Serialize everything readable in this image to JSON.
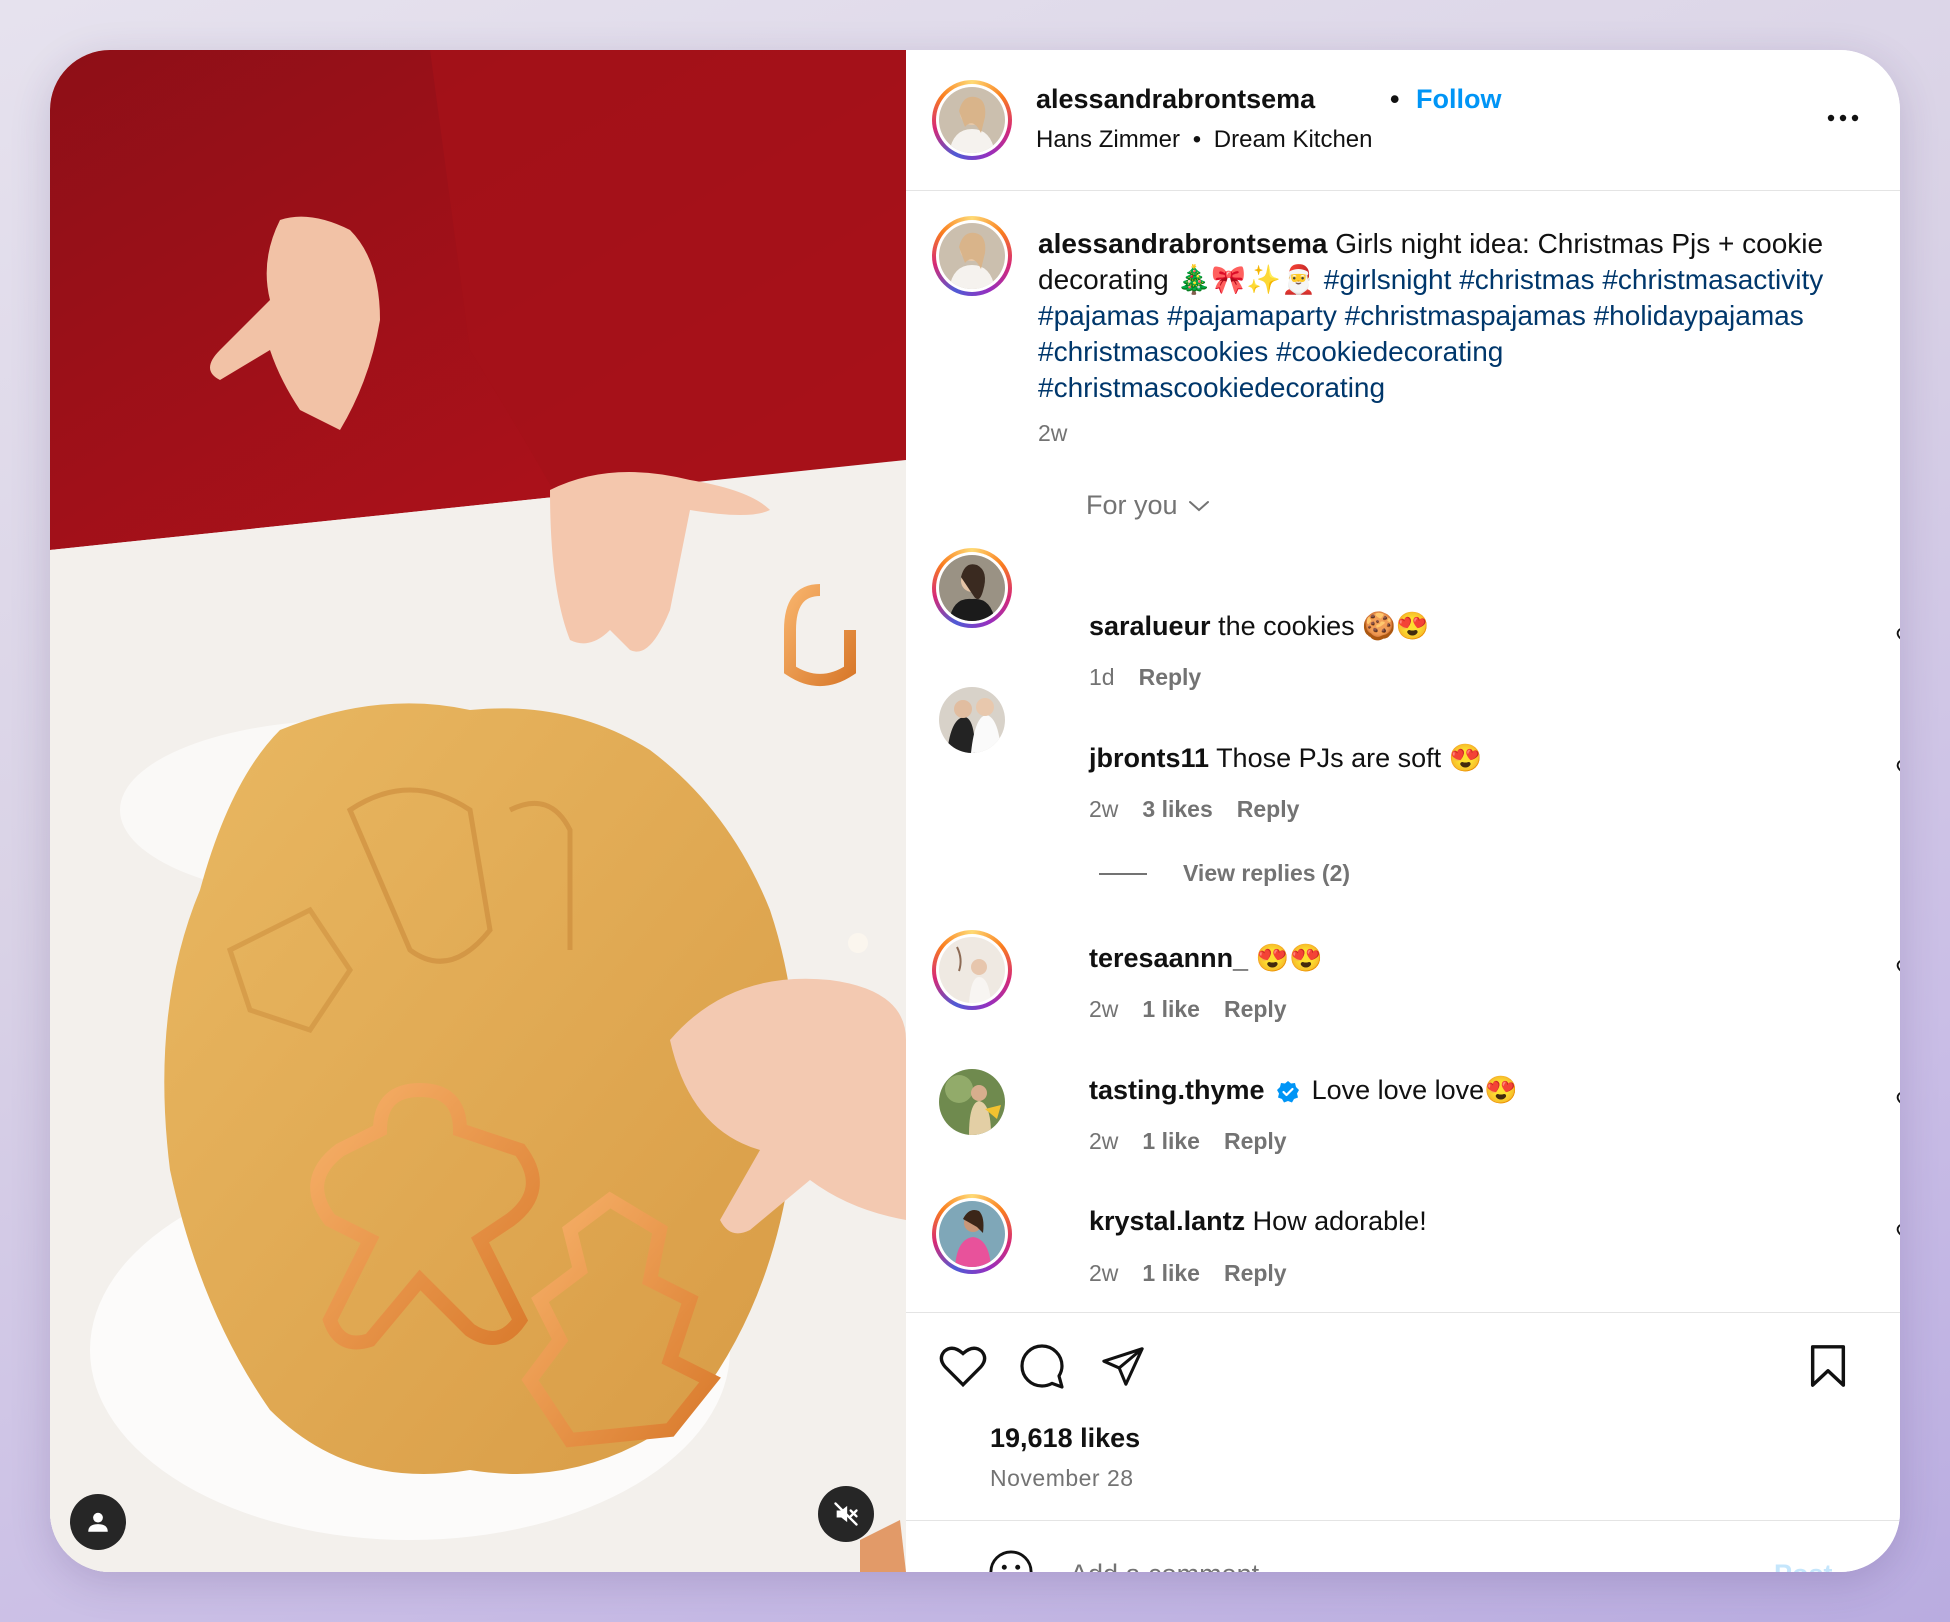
{
  "post": {
    "username": "alessandrabrontsema",
    "separator": "•",
    "follow_label": "Follow",
    "audio_artist": "Hans Zimmer",
    "audio_sep": "•",
    "audio_track": "Dream Kitchen",
    "caption_text": "Girls night idea: Christmas Pjs + cookie decorating 🎄🎀✨🎅",
    "hashtags": "#girlsnight #christmas #christmasactivity #pajamas #pajamaparty #christmaspajamas #holidaypajamas #christmascookies #cookiedecorating #christmascookiedecorating",
    "caption_time": "2w",
    "likes": "19,618 likes",
    "date": "November 28"
  },
  "comments_filter": "For you",
  "comments": [
    {
      "username": "saralueur",
      "text": "the cookies 🍪😍",
      "time": "1d",
      "likes": "",
      "reply": "Reply"
    },
    {
      "username": "jbronts11",
      "text": "Those PJs are soft 😍",
      "time": "2w",
      "likes": "3 likes",
      "reply": "Reply"
    },
    {
      "username": "teresaannn_",
      "text": "😍😍",
      "time": "2w",
      "likes": "1 like",
      "reply": "Reply"
    },
    {
      "username": "tasting.thyme",
      "text": "Love love love😍",
      "time": "2w",
      "likes": "1 like",
      "reply": "Reply"
    },
    {
      "username": "krystal.lantz",
      "text": "How adorable!",
      "time": "2w",
      "likes": "1 like",
      "reply": "Reply"
    }
  ],
  "view_replies": "View replies (2)",
  "add_comment": {
    "placeholder": "Add a comment...",
    "post_label": "Post"
  },
  "icons": {
    "more": "more-horizontal-icon",
    "heart": "heart-icon",
    "comment": "comment-icon",
    "share": "send-icon",
    "save": "bookmark-icon",
    "emoji": "emoji-icon",
    "mute": "speaker-muted-icon",
    "profile": "user-icon",
    "verified": "verified-badge-icon"
  },
  "colors": {
    "link": "#0095f6",
    "hashtag": "#00376b",
    "muted": "#737373",
    "verified": "#0095f6"
  }
}
